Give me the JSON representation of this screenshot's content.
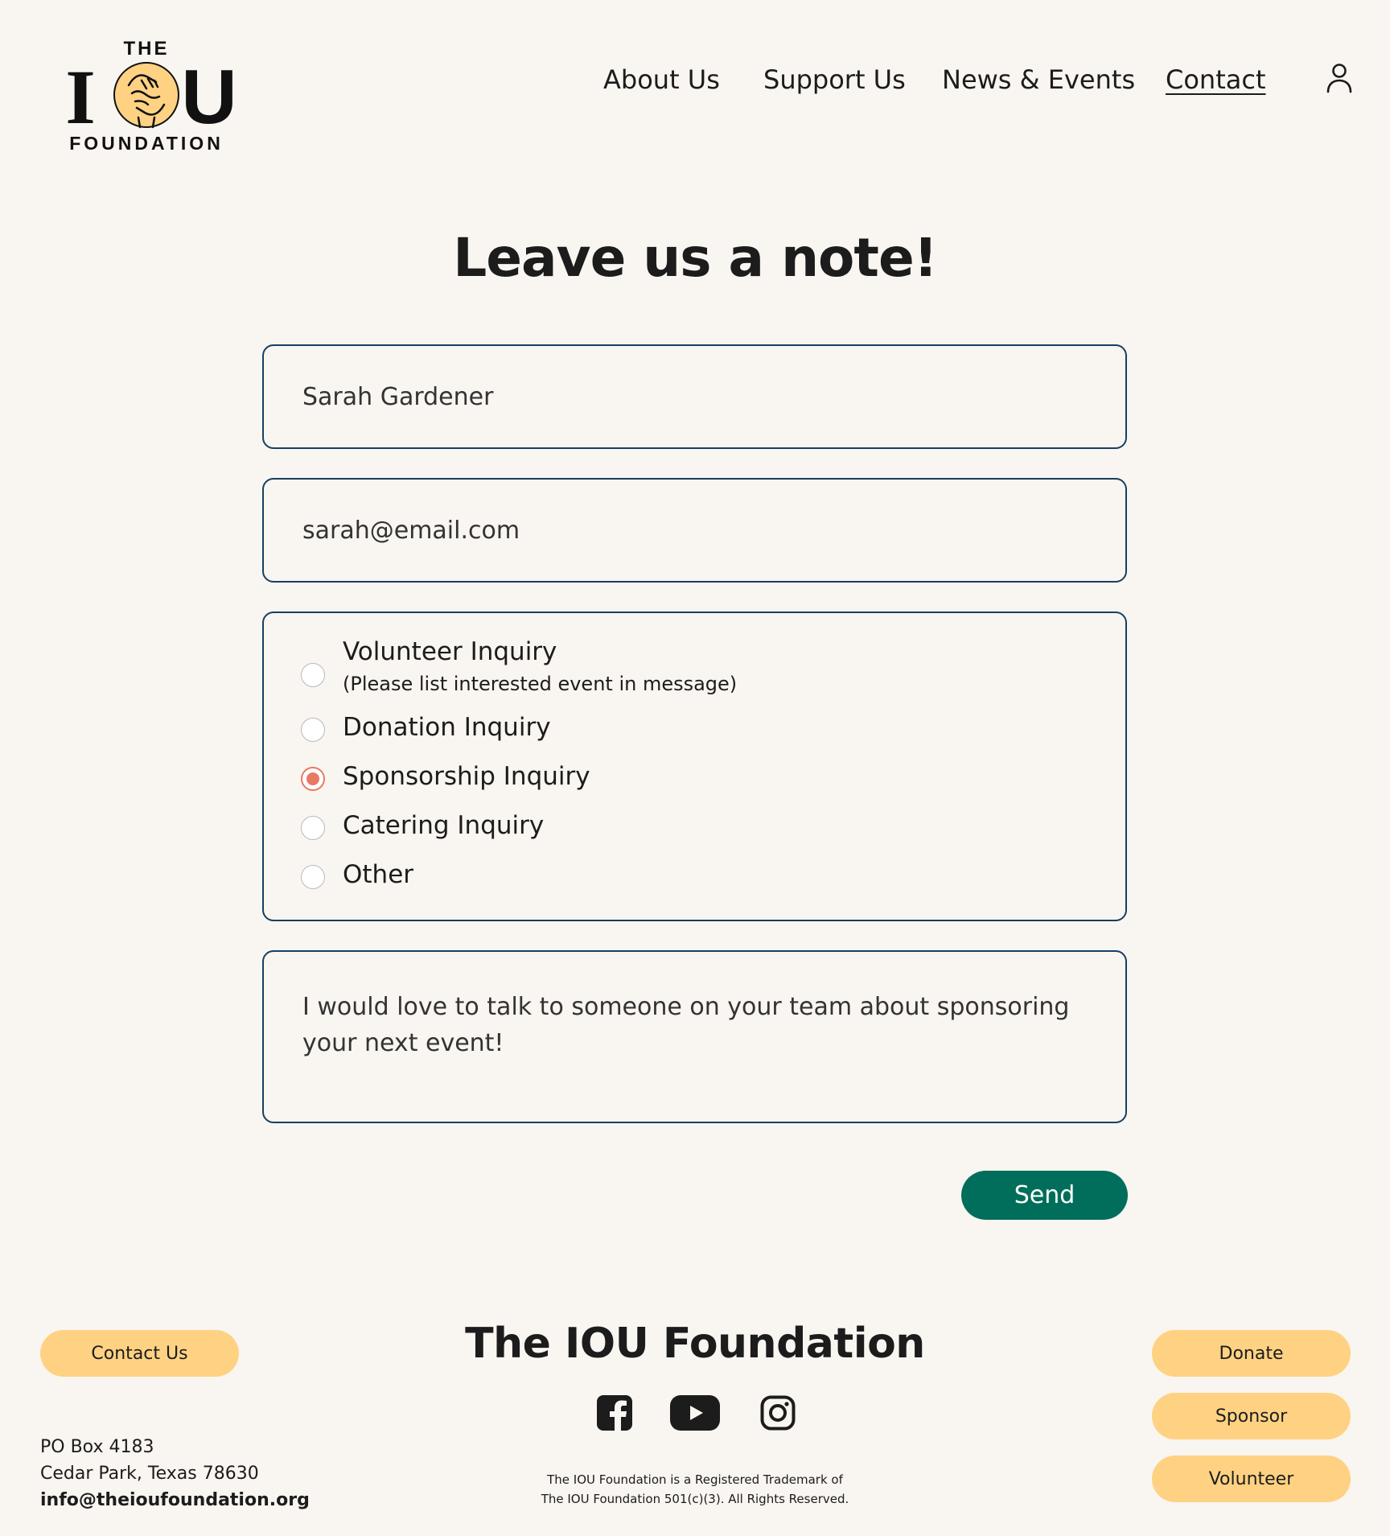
{
  "brand": {
    "logo_top": "THE",
    "logo_left": "I",
    "logo_right": "U",
    "logo_bottom": "FOUNDATION"
  },
  "nav": {
    "items": [
      "About Us",
      "Support Us",
      "News & Events",
      "Contact"
    ],
    "active": "Contact"
  },
  "page_title": "Leave us a note!",
  "form": {
    "name_value": "Sarah Gardener",
    "email_value": "sarah@email.com",
    "inquiry_options": [
      {
        "label": "Volunteer Inquiry",
        "sub": "(Please list interested event in message)",
        "checked": false
      },
      {
        "label": "Donation Inquiry",
        "checked": false
      },
      {
        "label": "Sponsorship Inquiry",
        "checked": true
      },
      {
        "label": "Catering Inquiry",
        "checked": false
      },
      {
        "label": "Other",
        "checked": false
      }
    ],
    "message_value": "I would love to talk to someone on your team about sponsoring your next event!",
    "send_label": "Send"
  },
  "footer": {
    "title": "The IOU Foundation",
    "contact_label": "Contact Us",
    "actions": [
      "Donate",
      "Sponsor",
      "Volunteer"
    ],
    "address": [
      "PO Box 4183",
      "Cedar Park, Texas 78630"
    ],
    "email": "info@theioufoundation.org",
    "legal": [
      "The IOU Foundation is a Registered Trademark of",
      "The IOU Foundation 501(c)(3). All Rights Reserved."
    ],
    "social": [
      "facebook-icon",
      "youtube-icon",
      "instagram-icon"
    ]
  },
  "colors": {
    "background": "#f9f5f0",
    "border": "#173f63",
    "send_button": "#006e5a",
    "pill_button": "#fed282",
    "radio_checked": "#e87a62",
    "logo_circle": "#fed282",
    "text": "#1c1c1c"
  }
}
